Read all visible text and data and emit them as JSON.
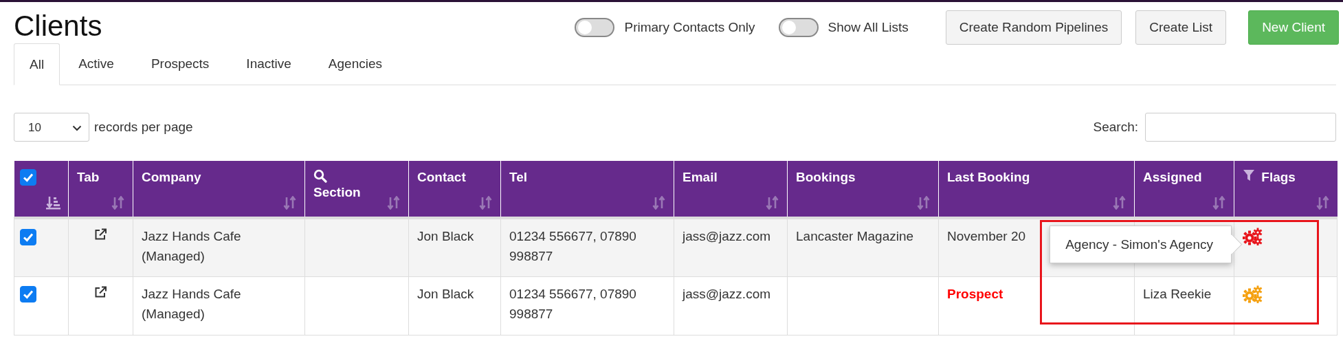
{
  "page_title": "Clients",
  "toggles": [
    {
      "label": "Primary Contacts Only",
      "on": false
    },
    {
      "label": "Show All Lists",
      "on": false
    }
  ],
  "buttons": [
    {
      "label": "Create Random Pipelines",
      "kind": "default"
    },
    {
      "label": "Create List",
      "kind": "default"
    },
    {
      "label": "New Client",
      "kind": "primary"
    }
  ],
  "tabs": [
    {
      "label": "All",
      "selected": true
    },
    {
      "label": "Active",
      "selected": false
    },
    {
      "label": "Prospects",
      "selected": false
    },
    {
      "label": "Inactive",
      "selected": false
    },
    {
      "label": "Agencies",
      "selected": false
    }
  ],
  "page_length": {
    "value": "10",
    "label": "records per page"
  },
  "search": {
    "label": "Search:"
  },
  "table": {
    "select_all_checked": true,
    "columns": [
      {
        "kind": "select",
        "sorted": true
      },
      {
        "kind": "text",
        "label": "Tab",
        "sorted": false
      },
      {
        "kind": "text",
        "label": "Company",
        "sorted": false
      },
      {
        "kind": "text",
        "label": "Section",
        "sorted": false
      },
      {
        "kind": "text",
        "label": "Contact",
        "sorted": false
      },
      {
        "kind": "text",
        "label": "Tel",
        "sorted": false
      },
      {
        "kind": "text",
        "label": "Email",
        "sorted": false
      },
      {
        "kind": "text",
        "label": "Bookings",
        "sorted": false
      },
      {
        "kind": "text",
        "label": "Last Booking",
        "sorted": false
      },
      {
        "kind": "text",
        "label": "Assigned",
        "sorted": false
      },
      {
        "kind": "text",
        "label": "Flags",
        "sorted": false
      }
    ],
    "rows": [
      {
        "checked": true,
        "company": "Jazz Hands Cafe (Managed)",
        "contact": "Jon Black",
        "tel": "01234 556677, 07890 998877",
        "email": "jass@jazz.com",
        "bookings": "Lancaster Magazine",
        "last_booking": {
          "text": "November 20",
          "kind": "date"
        },
        "flag": {
          "color": "#e8141b"
        },
        "tooltip": "Agency - Simon's Agency"
      },
      {
        "checked": true,
        "company": "Jazz Hands Cafe (Managed)",
        "contact": "Jon Black",
        "tel": "01234 556677, 07890 998877",
        "email": "jass@jazz.com",
        "last_booking": {
          "text": "Prospect",
          "kind": "prospect"
        },
        "assigned": "Liza Reekie",
        "flag": {
          "color": "#f5a00f"
        }
      }
    ]
  },
  "annotation": {
    "kind": "highlight-box"
  }
}
